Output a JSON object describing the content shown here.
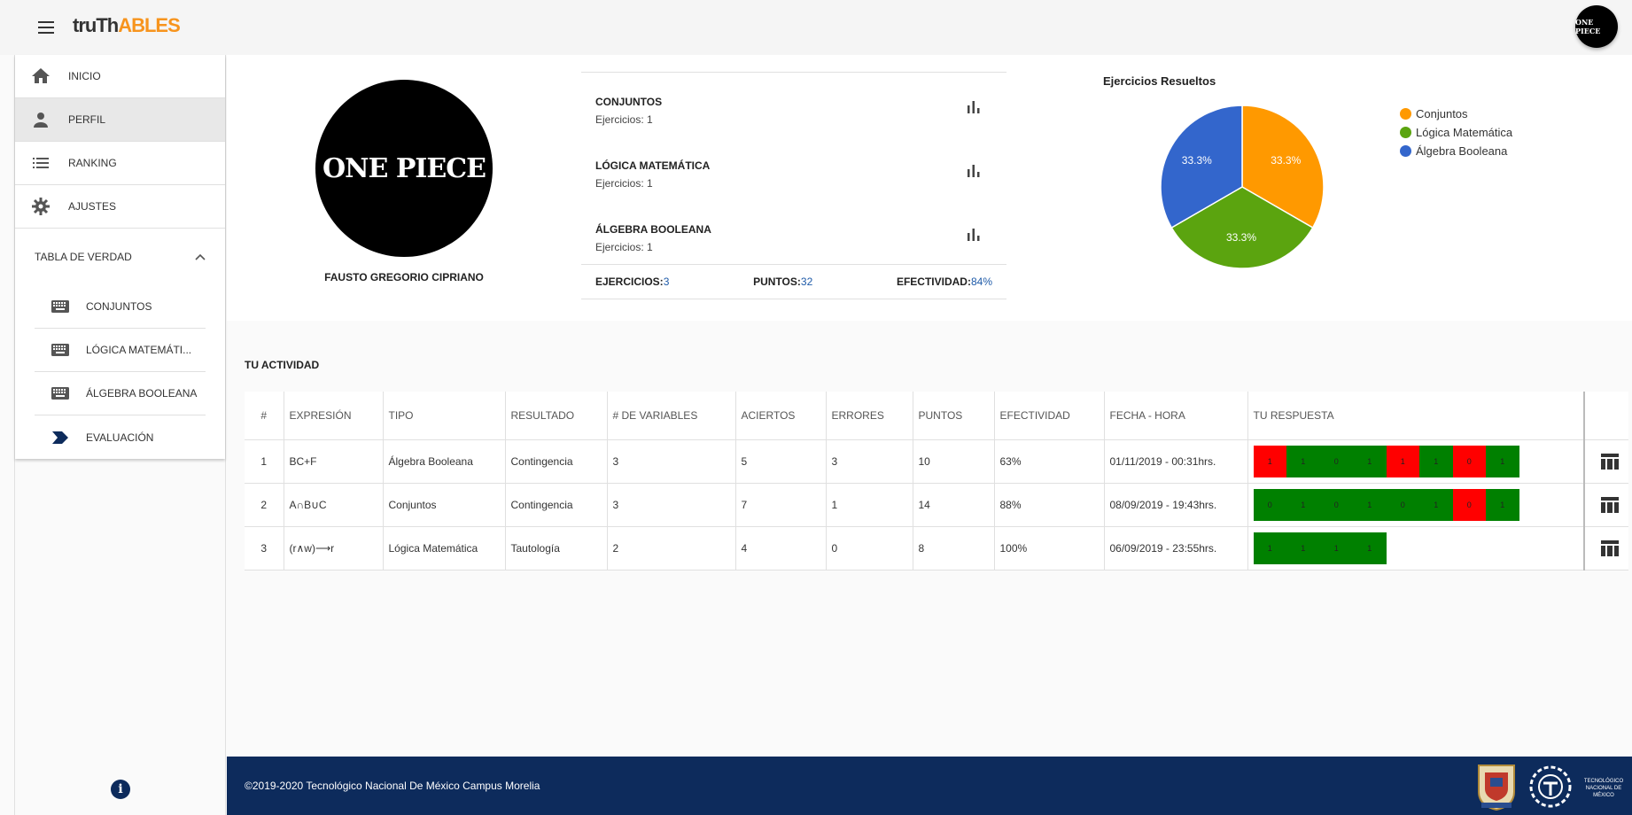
{
  "app": {
    "logo_part1": "truTh",
    "logo_part2": "ABLES",
    "avatar_text": "ONE PIECE"
  },
  "sidebar": {
    "items": [
      {
        "label": "INICIO",
        "icon": "home-icon"
      },
      {
        "label": "PERFIL",
        "icon": "person-icon"
      },
      {
        "label": "RANKING",
        "icon": "list-icon"
      },
      {
        "label": "AJUSTES",
        "icon": "gear-icon"
      }
    ],
    "group_label": "TABLA DE VERDAD",
    "sub_items": [
      {
        "label": "CONJUNTOS",
        "icon": "keyboard-icon"
      },
      {
        "label": "LÓGICA MATEMÁTI...",
        "icon": "keyboard-icon"
      },
      {
        "label": "ÁLGEBRA BOOLEANA",
        "icon": "keyboard-icon"
      },
      {
        "label": "EVALUACIÓN",
        "icon": "chevron-label-icon"
      }
    ]
  },
  "profile": {
    "avatar_text": "ONE PIECE",
    "name": "FAUSTO GREGORIO CIPRIANO",
    "stats": [
      {
        "title": "CONJUNTOS",
        "sub": "Ejercicios: 1"
      },
      {
        "title": "LÓGICA MATEMÁTICA",
        "sub": "Ejercicios: 1"
      },
      {
        "title": "ÁLGEBRA BOOLEANA",
        "sub": "Ejercicios: 1"
      }
    ],
    "footer": {
      "ejercicios_label": "EJERCICIOS:",
      "ejercicios_value": "3",
      "puntos_label": "PUNTOS:",
      "puntos_value": "32",
      "efectividad_label": "EFECTIVIDAD:",
      "efectividad_value": "84%"
    }
  },
  "chart_data": {
    "type": "pie",
    "title": "Ejercicios Resueltos",
    "labels": [
      "Conjuntos",
      "Lógica Matemática",
      "Álgebra Booleana"
    ],
    "values": [
      33.3,
      33.3,
      33.3
    ],
    "value_labels": [
      "33.3%",
      "33.3%",
      "33.3%"
    ],
    "colors": [
      "#ff9900",
      "#5ba40f",
      "#3366cc"
    ],
    "legend_position": "right"
  },
  "activity": {
    "title": "TU ACTIVIDAD",
    "headers": [
      "#",
      "EXPRESIÓN",
      "TIPO",
      "RESULTADO",
      "# DE VARIABLES",
      "ACIERTOS",
      "ERRORES",
      "PUNTOS",
      "EFECTIVIDAD",
      "FECHA - HORA",
      "TU RESPUESTA"
    ],
    "rows": [
      {
        "num": "1",
        "expr": "BC+F",
        "tipo": "Álgebra Booleana",
        "resultado": "Contingencia",
        "vars": "3",
        "aciertos": "5",
        "errores": "3",
        "puntos": "10",
        "efectividad": "63%",
        "fecha": "01/11/2019 - 00:31hrs.",
        "respuesta": [
          {
            "v": "1",
            "ok": false
          },
          {
            "v": "1",
            "ok": true
          },
          {
            "v": "0",
            "ok": true
          },
          {
            "v": "1",
            "ok": true
          },
          {
            "v": "1",
            "ok": false
          },
          {
            "v": "1",
            "ok": true
          },
          {
            "v": "0",
            "ok": false
          },
          {
            "v": "1",
            "ok": true
          }
        ]
      },
      {
        "num": "2",
        "expr": "A∩B∪C",
        "tipo": "Conjuntos",
        "resultado": "Contingencia",
        "vars": "3",
        "aciertos": "7",
        "errores": "1",
        "puntos": "14",
        "efectividad": "88%",
        "fecha": "08/09/2019 - 19:43hrs.",
        "respuesta": [
          {
            "v": "0",
            "ok": true
          },
          {
            "v": "1",
            "ok": true
          },
          {
            "v": "0",
            "ok": true
          },
          {
            "v": "1",
            "ok": true
          },
          {
            "v": "0",
            "ok": true
          },
          {
            "v": "1",
            "ok": true
          },
          {
            "v": "0",
            "ok": false
          },
          {
            "v": "1",
            "ok": true
          }
        ]
      },
      {
        "num": "3",
        "expr": "(r∧w)⟶r",
        "tipo": "Lógica Matemática",
        "resultado": "Tautología",
        "vars": "2",
        "aciertos": "4",
        "errores": "0",
        "puntos": "8",
        "efectividad": "100%",
        "fecha": "06/09/2019 - 23:55hrs.",
        "respuesta": [
          {
            "v": "1",
            "ok": true
          },
          {
            "v": "1",
            "ok": true
          },
          {
            "v": "1",
            "ok": true
          },
          {
            "v": "1",
            "ok": true
          }
        ]
      }
    ]
  },
  "footer": {
    "text": "©2019-2020 Tecnológico Nacional De México Campus Morelia",
    "tecnm_text": "TECNOLÓGICO NACIONAL DE MÉXICO"
  },
  "colors": {
    "accent": "#f7941d",
    "footer_bg": "#0d2b5c",
    "correct": "#008000",
    "wrong": "#ff0000",
    "link_value": "#1e5aa8"
  }
}
